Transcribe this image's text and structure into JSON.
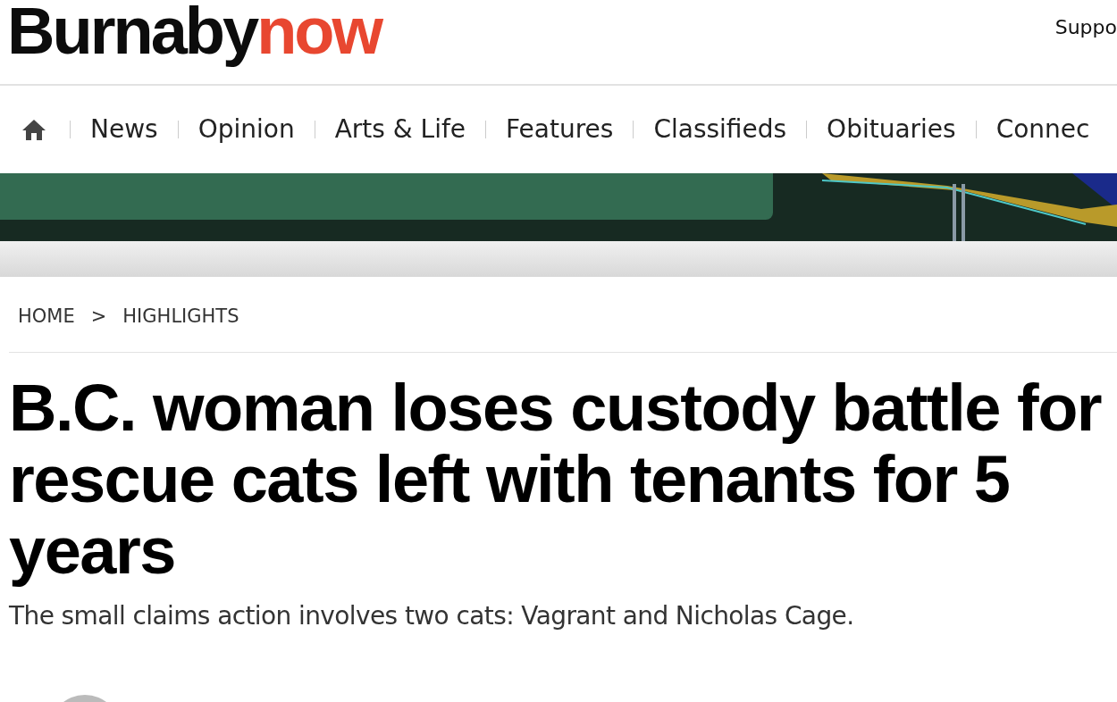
{
  "header": {
    "logo": {
      "main": "Burnaby",
      "accent": "now"
    },
    "link": "Suppo"
  },
  "nav": {
    "items": [
      {
        "label": "News"
      },
      {
        "label": "Opinion"
      },
      {
        "label": "Arts & Life"
      },
      {
        "label": "Features"
      },
      {
        "label": "Classifieds"
      },
      {
        "label": "Obituaries"
      },
      {
        "label": "Connec"
      }
    ]
  },
  "breadcrumb": [
    "HOME",
    ">",
    "HIGHLIGHTS"
  ],
  "article": {
    "headline": "B.C. woman loses custody battle for rescue cats left with tenants for 5 years",
    "subtitle": "The small claims action involves two cats: Vagrant and Nicholas Cage."
  }
}
